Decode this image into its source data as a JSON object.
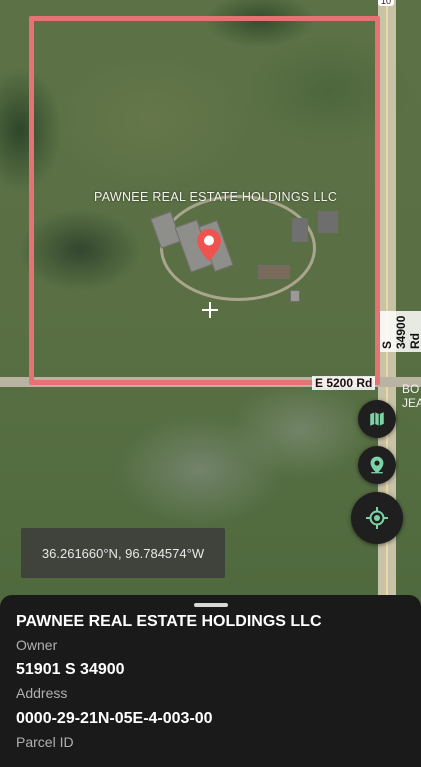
{
  "map": {
    "parcel_label": "PAWNEE REAL ESTATE HOLDINGS LLC",
    "road_vertical": "S 34900 Rd",
    "road_horizontal": "E 5200 Rd",
    "road_marker": "10",
    "edge_label_1": "BO",
    "edge_label_2": "JEA",
    "parcel_color": "#e57373",
    "pin_color": "#ef5350"
  },
  "controls": {
    "layers_icon": "map-icon",
    "pin_icon": "location-pin-icon",
    "locate_icon": "my-location-icon"
  },
  "coordinates": "36.261660°N, 96.784574°W",
  "sheet": {
    "owner_value": "PAWNEE REAL ESTATE HOLDINGS LLC",
    "owner_label": "Owner",
    "address_value": "51901 S 34900",
    "address_label": "Address",
    "parcel_value": "0000-29-21N-05E-4-003-00",
    "parcel_label": "Parcel ID"
  }
}
